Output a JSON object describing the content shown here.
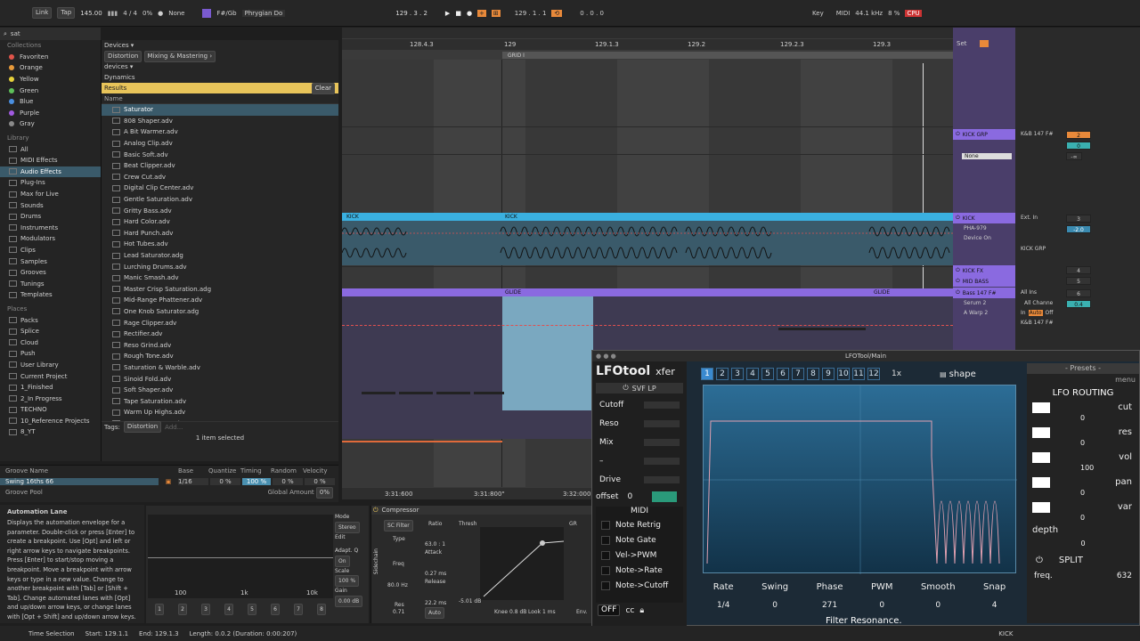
{
  "transport": {
    "link": "Link",
    "tap": "Tap",
    "tempo": "145.00",
    "meter": "4 / 4",
    "cpu_load": "0%",
    "rec_dot": "●",
    "quant": "None",
    "key_scale": "F#/Gb",
    "scale": "Phrygian Do",
    "position": "129 .  3 .  2",
    "loop_start": "129 .  1 .  1",
    "loop_len": "0 .  0 .  0",
    "key_label": "Key",
    "midi_label": "MIDI",
    "sample_rate": "44.1 kHz",
    "cpu_pct": "8 %",
    "cpu_label": "CPU"
  },
  "browser": {
    "search_value": "sat",
    "collections_title": "Collections",
    "collections": [
      {
        "label": "Favoriten",
        "color": "#e0544a"
      },
      {
        "label": "Orange",
        "color": "#e89a3a"
      },
      {
        "label": "Yellow",
        "color": "#e8d23a"
      },
      {
        "label": "Green",
        "color": "#5ec15a"
      },
      {
        "label": "Blue",
        "color": "#4a8fe0"
      },
      {
        "label": "Purple",
        "color": "#a15ae0"
      },
      {
        "label": "Gray",
        "color": "#8a8a8a"
      }
    ],
    "library_title": "Library",
    "library": [
      "All",
      "MIDI Effects",
      "Audio Effects",
      "Plug-Ins",
      "Max for Live",
      "Sounds",
      "Drums",
      "Instruments",
      "Modulators",
      "Clips",
      "Samples",
      "Grooves",
      "Tunings",
      "Templates"
    ],
    "places_title": "Places",
    "places": [
      "Packs",
      "Splice",
      "Cloud",
      "Push",
      "User Library",
      "Current Project",
      "1_Finished",
      "2_In Progress",
      "TECHNO",
      "10_Reference Projects",
      "8_YT"
    ],
    "crumb1": "Devices ▾",
    "crumb2a": "Distortion",
    "crumb2b": "Mixing & Mastering ›",
    "crumb3": "devices ▾",
    "crumb4": "Dynamics",
    "results_label": "Results",
    "clear_label": "Clear",
    "name_header": "Name",
    "items": [
      "Saturator",
      "808 Shaper.adv",
      "A Bit Warmer.adv",
      "Analog Clip.adv",
      "Basic Soft.adv",
      "Beat Clipper.adv",
      "Crew Cut.adv",
      "Digital Clip Center.adv",
      "Gentle Saturation.adv",
      "Gritty Bass.adv",
      "Hard Color.adv",
      "Hard Punch.adv",
      "Hot Tubes.adv",
      "Lead Saturator.adg",
      "Lurching Drums.adv",
      "Manic Smash.adv",
      "Master Crisp Saturation.adg",
      "Mid-Range Phattener.adv",
      "One Knob Saturator.adg",
      "Rage Clipper.adv",
      "Rectifier.adv",
      "Reso Grind.adv",
      "Rough Tone.adv",
      "Saturation & Warble.adv",
      "Sinoid Fold.adv",
      "Soft Shaper.adv",
      "Tape Saturation.adv",
      "Warm Up Highs.adv",
      "Warm Up Lows.adv"
    ],
    "tags_label": "Tags:",
    "tag_value": "Distortion",
    "tag_add": "Add...",
    "selected_status": "1 item selected"
  },
  "groove": {
    "headers": [
      "Groove Name",
      "Base",
      "Quantize",
      "Timing",
      "Random",
      "Velocity"
    ],
    "name": "Swing 16ths 66",
    "base": "1/16",
    "quantize": "0 %",
    "timing": "100 %",
    "random": "0 %",
    "velocity": "0 %",
    "pool_label": "Groove Pool",
    "global_label": "Global Amount",
    "global_value": "0%"
  },
  "arrangement": {
    "ruler": [
      "128.4.3",
      "129",
      "129.1.3",
      "129.2",
      "129.2.3",
      "129.3"
    ],
    "grid_label": "GRID I",
    "set_label": "Set",
    "kick_clip1": "KICK",
    "kick_clip2": "KICK",
    "glide1": "GLIDE",
    "glide2": "GLIDE",
    "time_ruler": [
      "3:31:600",
      "3:31:800\"",
      "3:32:000"
    ]
  },
  "tracks": [
    {
      "name": "KICK GRP",
      "input": "K&B 147 F#",
      "vol": "2",
      "pan": "0",
      "send": "-∞",
      "route": "None"
    },
    {
      "name": "KICK",
      "input": "Ext. In",
      "vol": "3",
      "pan": "-2.0",
      "chain1": "PHA-979",
      "chain2": "Device On",
      "route": "KICK GRP"
    },
    {
      "name": "KICK FX",
      "vol": "4"
    },
    {
      "name": "MID BASS",
      "vol": "5"
    },
    {
      "name": "Bass 147 F#",
      "input": "All Ins",
      "vol": "6",
      "pan": "0.4",
      "chain1": "Serum 2",
      "chain2": "A Warp 2",
      "chan": "All Channe",
      "route": "K&B 147 F#",
      "in_label": "In",
      "auto_label": "Auto",
      "off_label": "Off"
    }
  ],
  "automation_help": {
    "title": "Automation Lane",
    "text": "Displays the automation envelope for a parameter. Double-click or press [Enter] to create a breakpoint. Use [Opt] and left or right arrow keys to navigate breakpoints. Press [Enter] to start/stop moving a breakpoint. Move a breakpoint with arrow keys or type in a new value. Change to another breakpoint with [Tab] or [Shift + Tab]. Change automated lanes with [Opt] and up/down arrow keys, or change lanes with [Opt + Shift] and up/down arrow keys."
  },
  "eq": {
    "freq_labels": [
      "100",
      "1k",
      "10k"
    ],
    "bands": [
      "1",
      "2",
      "3",
      "4",
      "5",
      "6",
      "7",
      "8"
    ],
    "mode_label": "Mode",
    "mode_value": "Stereo",
    "edit_label": "Edit",
    "adapt_label": "Adapt. Q",
    "adapt_value": "On",
    "scale_label": "Scale",
    "scale_value": "100 %",
    "gain_label": "Gain",
    "gain_value": "0.00 dB"
  },
  "compressor": {
    "title": "Compressor",
    "sidechain": "Sidechain",
    "sc_filter": "SC Filter",
    "type_label": "Type",
    "freq_label": "Freq",
    "freq_value": "80.0 Hz",
    "res_label": "Res",
    "res_value": "0.71",
    "ratio_label": "Ratio",
    "ratio_value": "63.0 : 1",
    "attack_label": "Attack",
    "attack_value": "0.27 ms",
    "release_label": "Release",
    "release_value": "22.2 ms",
    "auto_label": "Auto",
    "thresh_label": "Thresh",
    "thresh_value": "-5.01 dB",
    "gr_label": "GR",
    "knee": "Knee 0.8 dB",
    "look": "Look 1 ms",
    "env": "Env."
  },
  "lfotool": {
    "window_title": "LFOTool/Main",
    "logo": "LFOtool",
    "brand": "xfer",
    "filter_type": "SVF LP",
    "params": [
      "Cutoff",
      "Reso",
      "Mix",
      "–",
      "Drive"
    ],
    "offset_label": "offset",
    "offset_value": "0",
    "midi_label": "MIDI",
    "midi_opts": [
      "Note Retrig",
      "Note Gate",
      "Vel->PWM",
      "Note->Rate",
      "Note->Cutoff"
    ],
    "off_label": "OFF",
    "cc_label": "cc",
    "tabs": [
      "1",
      "2",
      "3",
      "4",
      "5",
      "6",
      "7",
      "8",
      "9",
      "10",
      "11",
      "12"
    ],
    "mult": "1x",
    "shape_label": "shape",
    "bottom_params": [
      {
        "label": "Rate",
        "value": "1/4"
      },
      {
        "label": "Swing",
        "value": "0"
      },
      {
        "label": "Phase",
        "value": "271"
      },
      {
        "label": "PWM",
        "value": "0"
      },
      {
        "label": "Smooth",
        "value": "0"
      },
      {
        "label": "Snap",
        "value": "4"
      }
    ],
    "presets": "- Presets -",
    "menu": "menu",
    "routing_title": "LFO ROUTING",
    "routes": [
      {
        "label": "cut",
        "value": "0"
      },
      {
        "label": "res",
        "value": "0"
      },
      {
        "label": "vol",
        "value": "100"
      },
      {
        "label": "pan",
        "value": "0"
      },
      {
        "label": "var",
        "value": "0"
      }
    ],
    "depth_label": "depth",
    "depth_value": "0",
    "split_label": "SPLIT",
    "freq_label": "freq.",
    "freq_value": "632",
    "status": "Filter Resonance."
  },
  "status_bar": {
    "label": "Time Selection",
    "start": "Start: 129.1.1",
    "end": "End: 129.1.3",
    "length": "Length: 0.0.2  (Duration: 0:00:207)",
    "track": "KICK"
  }
}
